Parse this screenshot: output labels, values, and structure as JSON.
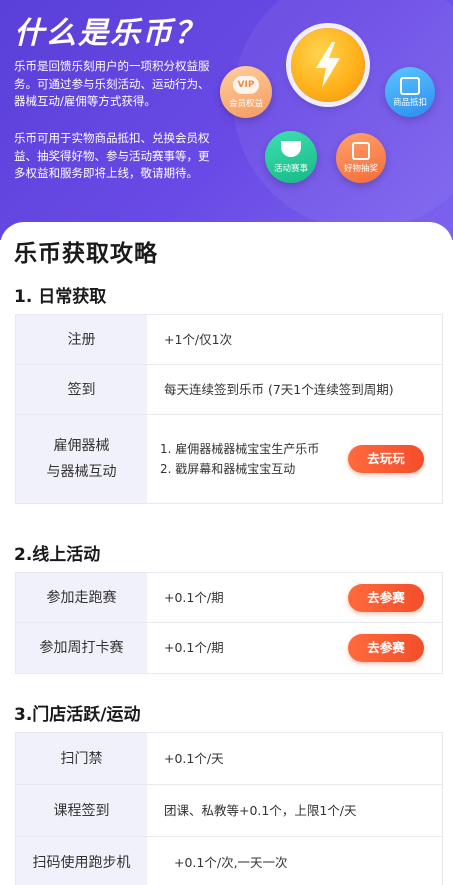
{
  "banner": {
    "title": "什么是乐币？",
    "paragraph1": "乐币是回馈乐刻用户的一项积分权益服务。可通过参与乐刻活动、运动行为、器械互动/雇佣等方式获得。",
    "paragraph2": "乐币可用于实物商品抵扣、兑换会员权益、抽奖得好物、参与活动赛事等，更多权益和服务即将上线，敬请期待。",
    "badges": {
      "vip_glyph": "VIP",
      "vip": "会员权益",
      "goods": "商品抵扣",
      "event": "活动赛事",
      "lottery": "好物抽奖"
    },
    "colors": {
      "banner": "#5a3fd8",
      "coin": "#ffb21a"
    }
  },
  "page_title": "乐币获取攻略",
  "sections": [
    {
      "title": "1. 日常获取",
      "rows": [
        {
          "label": "注册",
          "value": "+1个/仅1次"
        },
        {
          "label": "签到",
          "value": "每天连续签到乐币 (7天1个连续签到周期)"
        },
        {
          "label": "雇佣器械\n与器械互动",
          "value": "1. 雇佣器械器械宝宝生产乐币\n2. 戳屏幕和器械宝宝互动",
          "button": "去玩玩"
        }
      ]
    },
    {
      "title": "2.线上活动",
      "rows": [
        {
          "label": "参加走跑赛",
          "value": "+0.1个/期",
          "button": "去参赛"
        },
        {
          "label": "参加周打卡赛",
          "value": "+0.1个/期",
          "button": "去参赛"
        }
      ]
    },
    {
      "title": "3.门店活跃/运动",
      "rows": [
        {
          "label": "扫门禁",
          "value": "+0.1个/天"
        },
        {
          "label": "课程签到",
          "value": "团课、私教等+0.1个，上限1个/天"
        },
        {
          "label": "扫码使用跑步机",
          "value": "+0.1个/次,一天一次"
        }
      ]
    }
  ],
  "accent_color": "#f24e2a"
}
